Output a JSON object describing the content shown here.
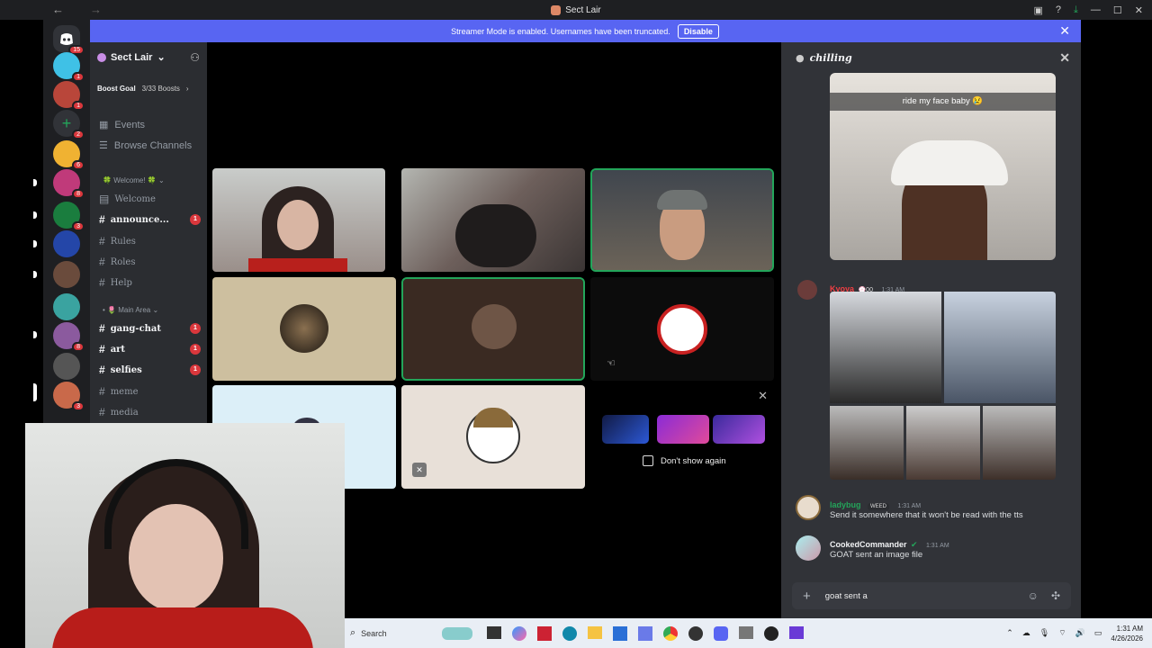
{
  "window": {
    "title": "Sect Lair"
  },
  "banner": {
    "text": "Streamer Mode is enabled. Usernames have been truncated.",
    "disable_label": "Disable"
  },
  "guild_badges": [
    "15",
    "1",
    "1",
    "2",
    "6",
    "8",
    "3",
    "8",
    "3"
  ],
  "server": {
    "name": "Sect Lair",
    "boost_goal_label": "Boost Goal",
    "boost_progress": "3/33 Boosts"
  },
  "sidebar_links": [
    {
      "label": "Events"
    },
    {
      "label": "Browse Channels"
    }
  ],
  "categories": {
    "welcome": "Welcome!",
    "main_area": "Main Area"
  },
  "channels": [
    {
      "label": "Welcome",
      "unread": false,
      "badge": ""
    },
    {
      "label": "announce...",
      "unread": true,
      "badge": "1"
    },
    {
      "label": "Rules",
      "unread": false,
      "badge": ""
    },
    {
      "label": "Roles",
      "unread": false,
      "badge": ""
    },
    {
      "label": "Help",
      "unread": false,
      "badge": ""
    },
    {
      "label": "gang-chat",
      "unread": true,
      "badge": "1"
    },
    {
      "label": "art",
      "unread": true,
      "badge": "1"
    },
    {
      "label": "selfies",
      "unread": true,
      "badge": "1"
    },
    {
      "label": "meme",
      "unread": false,
      "badge": ""
    },
    {
      "label": "media",
      "unread": false,
      "badge": ""
    }
  ],
  "promo": {
    "dont_show_label": "Don't show again"
  },
  "chat": {
    "channel_name": "chilling",
    "image_caption": "ride my face baby 😢",
    "messages": [
      {
        "author": "Kyoya",
        "tag": "💮00",
        "time": "1:31 AM",
        "text": "",
        "color": "#f23f43"
      },
      {
        "author": "ladybug",
        "tag": "WEED",
        "time": "1:31 AM",
        "text": "Send it somewhere that it won't be read with the tts",
        "color": "#23a55a"
      },
      {
        "author": "CookedCommander",
        "tag": "",
        "time": "1:31 AM",
        "text": "GOAT sent an image file",
        "color": "#f2f3f5"
      }
    ],
    "input_value": "goat sent a"
  },
  "taskbar": {
    "search_placeholder": "Search",
    "time": "1:31 AM",
    "date": "4/26/2026"
  },
  "colors": {
    "accent": "#5865f2",
    "speaking": "#23a55a",
    "badge": "#da373c"
  }
}
